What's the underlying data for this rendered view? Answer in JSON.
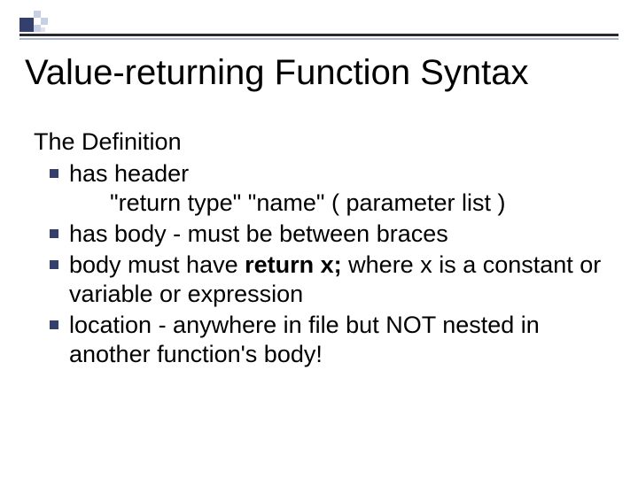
{
  "title": "Value-returning Function Syntax",
  "section_head": "The Definition",
  "bullets": {
    "b0_lead": "has header",
    "b0_sub": "\"return type\" \"name\"  ( parameter list )",
    "b1": "has body - must be between braces",
    "b2_a": "body must have ",
    "b2_bold": "return x;",
    "b2_b": " where x is a constant or variable or expression",
    "b3": "location - anywhere in file but NOT nested in  another function's body!"
  }
}
